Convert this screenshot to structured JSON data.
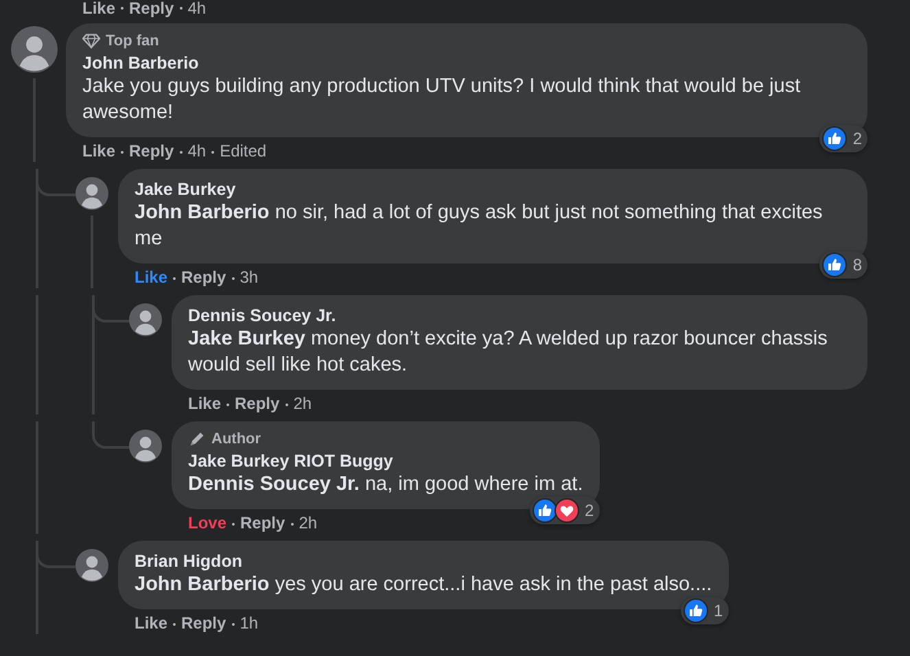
{
  "previous_actions": {
    "react": {
      "reacted": false,
      "label": "Like"
    },
    "reply_label": "Reply",
    "time": "4h"
  },
  "comments": [
    {
      "badge": {
        "kind": "top_fan",
        "label": "Top fan"
      },
      "name": "John Barberio",
      "text": "Jake you guys building any production UTV units? I would think that would be just awesome!",
      "react": {
        "reacted": false,
        "label": "Like"
      },
      "reply_label": "Reply",
      "time": "4h",
      "edited": "Edited",
      "reactions": [
        {
          "kind": "like"
        }
      ],
      "reaction_count": "2",
      "children": [
        {
          "name": "Jake Burkey",
          "text": "**John Barberio** no sir, had a lot of guys ask but just not something that excites me",
          "react": {
            "reacted": true,
            "label": "Like"
          },
          "reply_label": "Reply",
          "time": "3h",
          "reactions": [
            {
              "kind": "like"
            }
          ],
          "reaction_count": "8",
          "children": [
            {
              "name": "Dennis Soucey Jr.",
              "text": "**Jake Burkey** money don’t excite ya? A welded up razor bouncer chassis would sell like hot cakes.",
              "react": {
                "reacted": false,
                "label": "Like"
              },
              "reply_label": "Reply",
              "time": "2h"
            },
            {
              "badge": {
                "kind": "author",
                "label": "Author"
              },
              "name": "Jake Burkey RIOT Buggy",
              "text": "**Dennis Soucey Jr.** na, im good where im at.",
              "react": {
                "kind": "love",
                "reacted": true,
                "label": "Love"
              },
              "reply_label": "Reply",
              "time": "2h",
              "reactions": [
                {
                  "kind": "like"
                },
                {
                  "kind": "love"
                }
              ],
              "reaction_count": "2"
            }
          ]
        },
        {
          "name": "Brian Higdon",
          "text": "**John Barberio** yes you are correct...i have ask in the past also....",
          "react": {
            "reacted": false,
            "label": "Like"
          },
          "reply_label": "Reply",
          "time": "1h",
          "reactions": [
            {
              "kind": "like"
            }
          ],
          "reaction_count": "1"
        }
      ]
    }
  ]
}
